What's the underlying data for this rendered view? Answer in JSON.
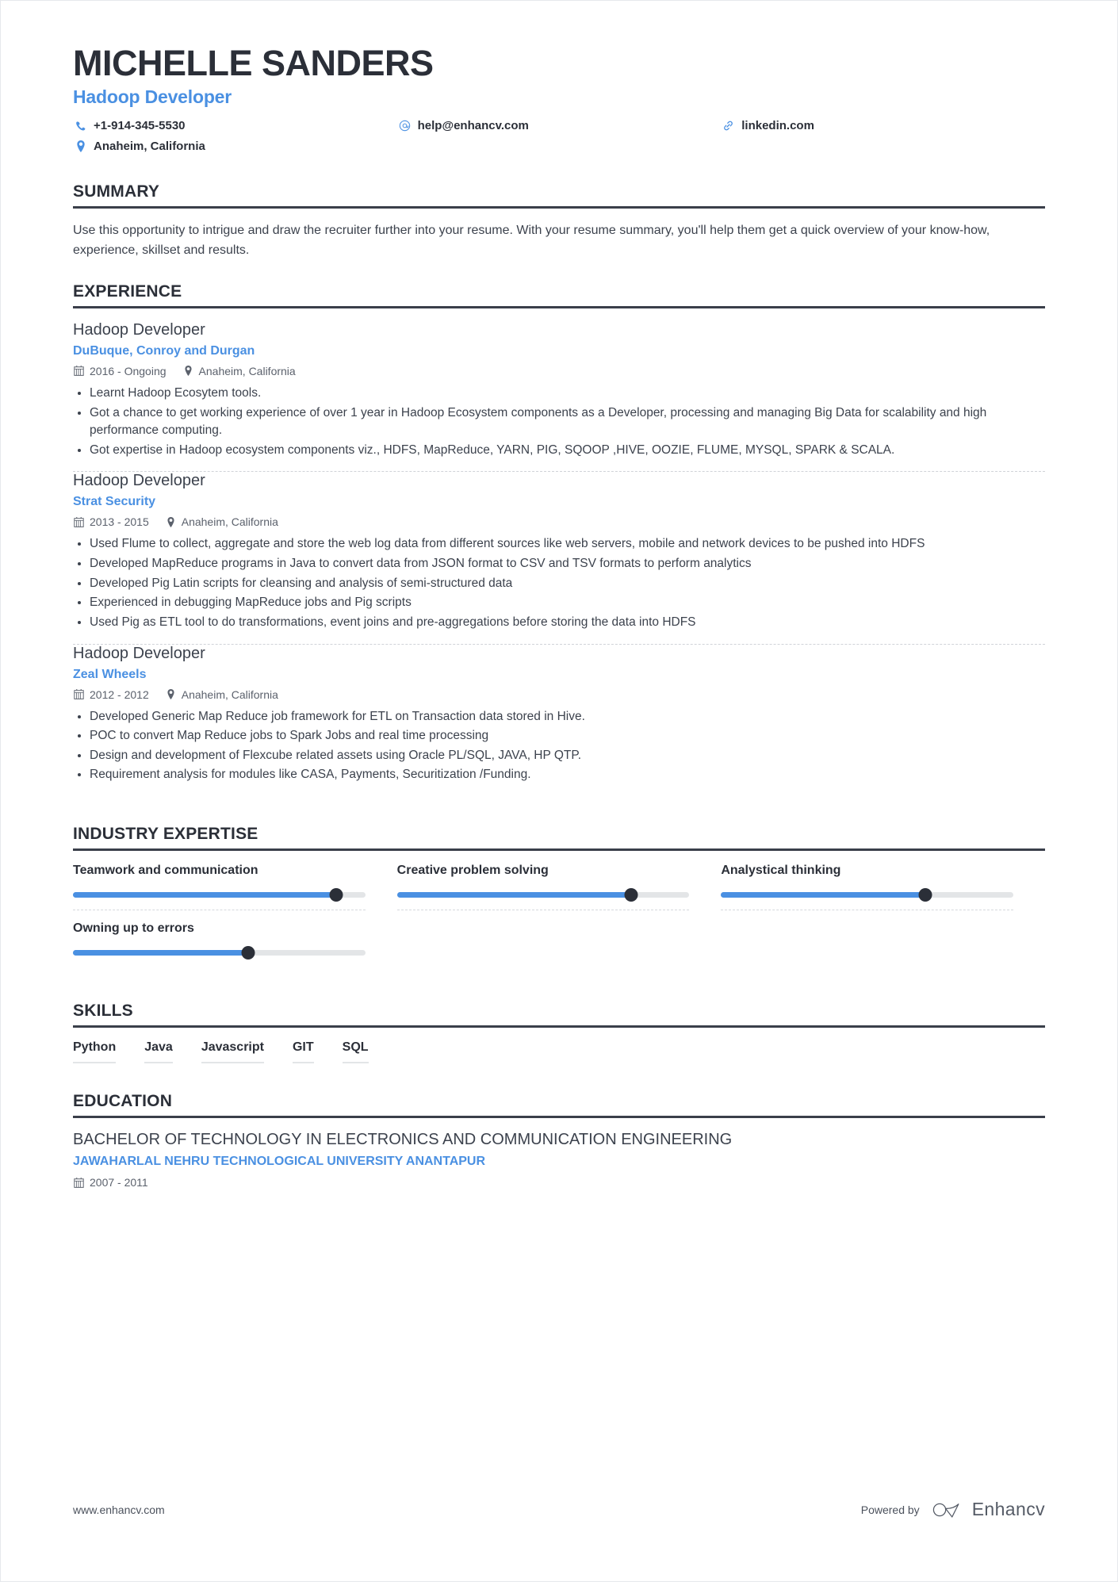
{
  "header": {
    "name": "MICHELLE SANDERS",
    "job_title": "Hadoop Developer",
    "accent_color": "#4a90e2",
    "contacts": [
      {
        "icon": "phone-icon",
        "value": "+1-914-345-5530"
      },
      {
        "icon": "email-icon",
        "value": "help@enhancv.com"
      },
      {
        "icon": "link-icon",
        "value": "linkedin.com"
      },
      {
        "icon": "location-icon",
        "value": "Anaheim, California"
      }
    ]
  },
  "summary": {
    "heading": "SUMMARY",
    "text": "Use this opportunity to intrigue and draw the recruiter further into your resume. With your resume summary, you'll help them get a quick overview of your know-how, experience, skillset and results."
  },
  "experience": {
    "heading": "EXPERIENCE",
    "entries": [
      {
        "role": "Hadoop Developer",
        "company": "DuBuque, Conroy and Durgan",
        "dates": "2016 - Ongoing",
        "location": "Anaheim, California",
        "bullets": [
          "Learnt Hadoop Ecosytem tools.",
          "Got a chance to get working experience of over 1 year in Hadoop Ecosystem components as a Developer, processing and managing Big Data for scalability and high performance computing.",
          "Got expertise in Hadoop ecosystem components viz., HDFS, MapReduce, YARN, PIG, SQOOP ,HIVE, OOZIE, FLUME, MYSQL, SPARK & SCALA."
        ]
      },
      {
        "role": "Hadoop Developer",
        "company": "Strat Security",
        "dates": "2013 - 2015",
        "location": "Anaheim, California",
        "bullets": [
          "Used Flume to collect, aggregate and store the web log data from different sources like web servers, mobile and network devices to be pushed into HDFS",
          "Developed MapReduce programs in Java to convert data from JSON format to CSV and TSV formats to perform analytics",
          "Developed Pig Latin scripts for cleansing and analysis of semi-structured data",
          "Experienced in debugging MapReduce jobs and Pig scripts",
          "Used Pig as ETL tool to do transformations, event joins and pre-aggregations before storing the data into HDFS"
        ]
      },
      {
        "role": "Hadoop Developer",
        "company": "Zeal Wheels",
        "dates": "2012 - 2012",
        "location": "Anaheim, California",
        "bullets": [
          "Developed Generic Map Reduce job framework for ETL on Transaction data stored in Hive.",
          "POC to convert Map Reduce jobs to Spark Jobs and real time processing",
          "Design and development of Flexcube related assets using Oracle PL/SQL, JAVA, HP QTP.",
          "Requirement analysis for modules like CASA, Payments, Securitization /Funding."
        ]
      }
    ]
  },
  "industry_expertise": {
    "heading": "INDUSTRY EXPERTISE",
    "items": [
      {
        "label": "Teamwork and communication",
        "value": 90
      },
      {
        "label": "Creative problem solving",
        "value": 80
      },
      {
        "label": "Analystical thinking",
        "value": 70
      },
      {
        "label": "Owning up to errors",
        "value": 60
      }
    ]
  },
  "skills": {
    "heading": "SKILLS",
    "items": [
      "Python",
      "Java",
      "Javascript",
      "GIT",
      "SQL"
    ]
  },
  "education": {
    "heading": "EDUCATION",
    "entries": [
      {
        "degree": "BACHELOR OF TECHNOLOGY IN ELECTRONICS AND COMMUNICATION ENGINEERING",
        "school": "JAWAHARLAL NEHRU TECHNOLOGICAL UNIVERSITY ANANTAPUR",
        "dates": "2007 - 2011"
      }
    ]
  },
  "footer": {
    "url": "www.enhancv.com",
    "powered_by": "Powered by",
    "brand": "Enhancv"
  }
}
